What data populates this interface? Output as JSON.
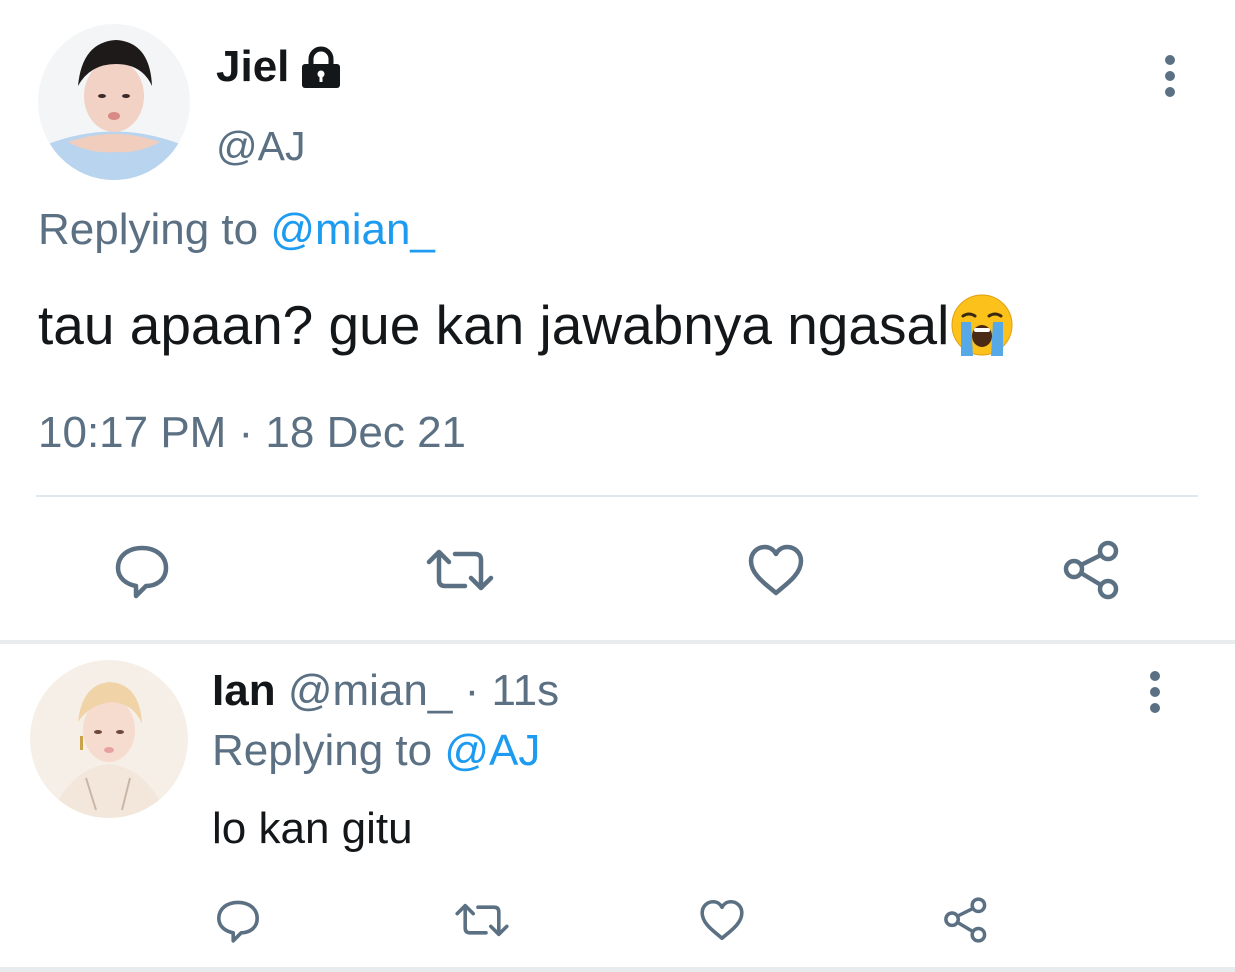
{
  "main_tweet": {
    "display_name": "Jiel",
    "handle": "@AJ",
    "replying_prefix": "Replying to",
    "replying_to": "@mian_",
    "text": "tau apaan? gue kan jawabnya ngasal",
    "emoji": "😭",
    "timestamp": "10:17 PM · 18 Dec 21",
    "icons": {
      "protected": "lock-icon",
      "more": "more-vertical-icon",
      "reply": "reply-icon",
      "retweet": "retweet-icon",
      "like": "heart-icon",
      "share": "share-icon"
    }
  },
  "reply_tweet": {
    "display_name": "Ian",
    "handle": "@mian_",
    "time_ago": "· 11s",
    "replying_prefix": "Replying to",
    "replying_to": "@AJ",
    "text": "lo kan gitu"
  },
  "colors": {
    "muted": "#5b7083",
    "link": "#1d9bf0",
    "text": "#14171a",
    "divider": "#e1e8ed"
  }
}
